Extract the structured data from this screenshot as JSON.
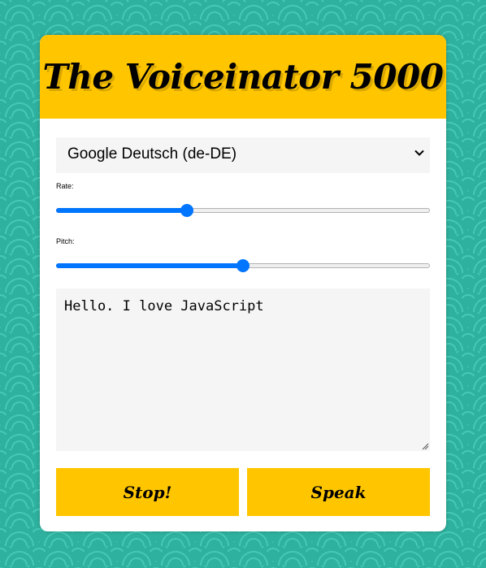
{
  "app": {
    "title": "The Voiceinator 5000"
  },
  "voice_select": {
    "selected": "Google Deutsch (de-DE)"
  },
  "rate": {
    "label": "Rate:",
    "level_fraction": 0.345
  },
  "pitch": {
    "label": "Pitch:",
    "level_fraction": 0.5
  },
  "text_input": {
    "value": "Hello. I love JavaScript"
  },
  "buttons": {
    "stop_label": "Stop!",
    "speak_label": "Speak"
  },
  "colors": {
    "accent": "#ffc600",
    "slider": "#0075ff",
    "background": "#3bbfad"
  }
}
